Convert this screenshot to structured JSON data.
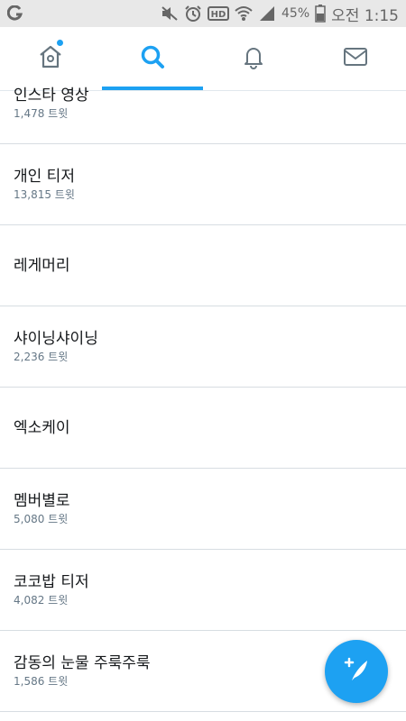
{
  "status_bar": {
    "battery_percent": "45%",
    "time": "오전 1:15",
    "icons": [
      "app-icon",
      "mute-icon",
      "alarm-icon",
      "hd-icon",
      "wifi-icon",
      "signal-icon",
      "battery-icon"
    ]
  },
  "tabs": [
    {
      "name": "home",
      "icon": "home-icon",
      "active": false,
      "has_dot": true
    },
    {
      "name": "search",
      "icon": "search-icon",
      "active": true,
      "has_dot": false
    },
    {
      "name": "notifications",
      "icon": "bell-icon",
      "active": false,
      "has_dot": false
    },
    {
      "name": "messages",
      "icon": "mail-icon",
      "active": false,
      "has_dot": false
    }
  ],
  "trends": [
    {
      "name": "인스타 영상",
      "count": "1,478 트윗"
    },
    {
      "name": "개인 티저",
      "count": "13,815 트윗"
    },
    {
      "name": "레게머리",
      "count": ""
    },
    {
      "name": "샤이닝샤이닝",
      "count": "2,236 트윗"
    },
    {
      "name": "엑소케이",
      "count": ""
    },
    {
      "name": "멤버별로",
      "count": "5,080 트윗"
    },
    {
      "name": "코코밥 티저",
      "count": "4,082 트윗"
    },
    {
      "name": "감동의 눈물 주룩주룩",
      "count": "1,586 트윗"
    }
  ],
  "compose_button": {
    "icon": "compose-tweet-icon"
  },
  "colors": {
    "accent": "#1da1f2",
    "icon_gray": "#66757f",
    "status_bar_bg": "#e8e8e8"
  }
}
